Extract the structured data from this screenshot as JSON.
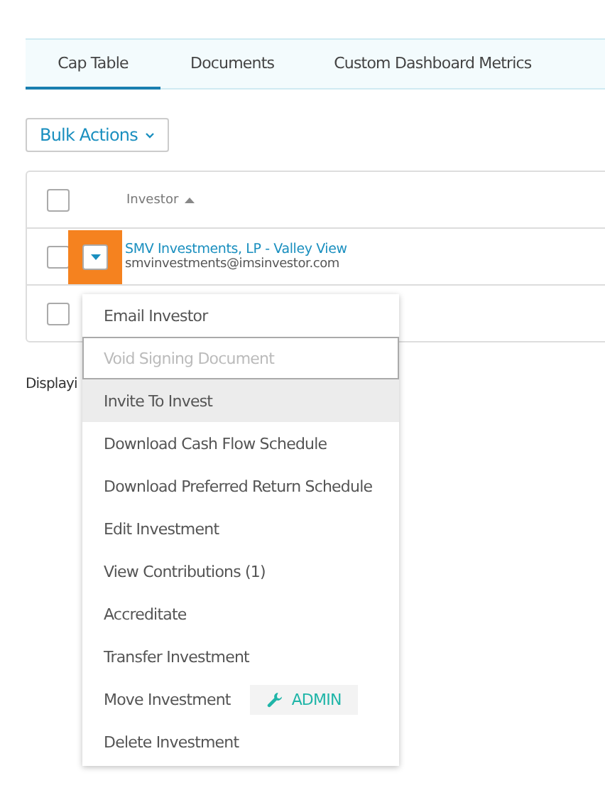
{
  "tabs": [
    {
      "label": "Cap Table",
      "selected": true
    },
    {
      "label": "Documents",
      "selected": false
    },
    {
      "label": "Custom Dashboard Metrics",
      "selected": false
    }
  ],
  "bulk_actions": {
    "label": "Bulk Actions"
  },
  "table": {
    "header_checked": false,
    "columns": [
      {
        "label": "Investor",
        "sorted": true
      }
    ],
    "rows": [
      {
        "name": "SMV Investments, LP - Valley View",
        "email": "smvinvestments@imsinvestor.com",
        "checked": false,
        "menu_open": true
      },
      {
        "checked": false
      }
    ]
  },
  "footer_text": "Displayi",
  "row_menu": {
    "items": [
      {
        "label": "Email Investor",
        "disabled": false,
        "focused": false,
        "hovered": false
      },
      {
        "label": "Void Signing Document",
        "disabled": true,
        "focused": true,
        "hovered": false
      },
      {
        "label": "Invite To Invest",
        "disabled": false,
        "focused": false,
        "hovered": true
      },
      {
        "label": "Download Cash Flow Schedule",
        "disabled": false,
        "focused": false,
        "hovered": false
      },
      {
        "label": "Download Preferred Return Schedule",
        "disabled": false,
        "focused": false,
        "hovered": false
      },
      {
        "label": "Edit Investment",
        "disabled": false,
        "focused": false,
        "hovered": false
      },
      {
        "label": "View Contributions (1)",
        "disabled": false,
        "focused": false,
        "hovered": false
      },
      {
        "label": "Accreditate",
        "disabled": false,
        "focused": false,
        "hovered": false
      },
      {
        "label": "Transfer Investment",
        "disabled": false,
        "focused": false,
        "hovered": false
      },
      {
        "label": "Move Investment",
        "disabled": false,
        "focused": false,
        "hovered": false,
        "badge": "ADMIN"
      },
      {
        "label": "Delete Investment",
        "disabled": false,
        "focused": false,
        "hovered": false
      }
    ]
  }
}
